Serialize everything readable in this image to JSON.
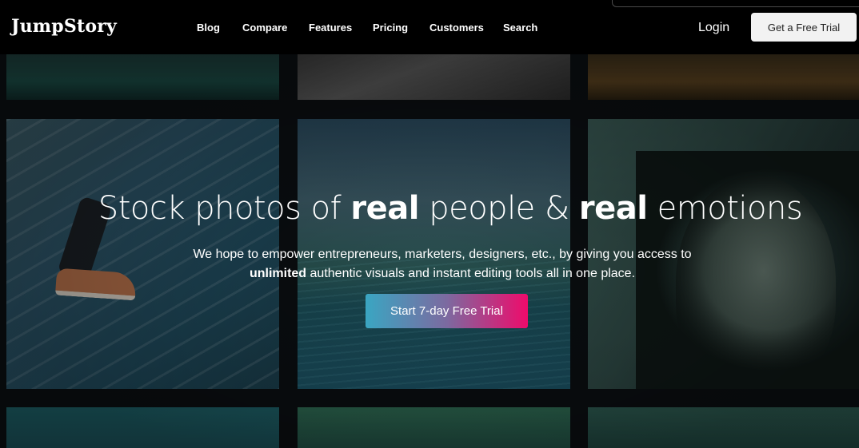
{
  "brand": {
    "logo_text": "JumpStory"
  },
  "nav": {
    "items": [
      {
        "label": "Blog"
      },
      {
        "label": "Compare"
      },
      {
        "label": "Features"
      },
      {
        "label": "Pricing"
      },
      {
        "label": "Customers"
      },
      {
        "label": "Search"
      }
    ],
    "login_label": "Login",
    "trial_button_label": "Get a Free Trial"
  },
  "hero": {
    "title_part1": "Stock photos of ",
    "title_bold1": "real",
    "title_part2": " people & ",
    "title_bold2": "real",
    "title_part3": " emotions",
    "subtitle_line1": "We hope to empower entrepreneurs, marketers, designers, etc., by giving you access to",
    "subtitle_bold": "unlimited",
    "subtitle_line2": " authentic visuals and instant editing tools all in one place.",
    "cta_label": "Start 7-day Free Trial"
  },
  "theme": {
    "nav_background": "#000000",
    "cta_gradient_start": "#3aa6c2",
    "cta_gradient_end": "#ef0b6b",
    "trial_button_background": "#f2f2f2"
  }
}
